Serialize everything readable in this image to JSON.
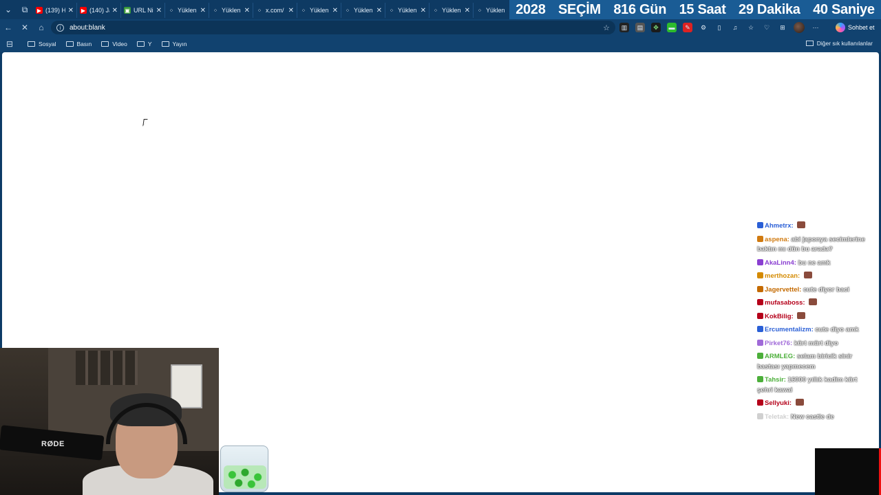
{
  "tabs": [
    {
      "title": "(139) H",
      "fav_color": "#ff0000",
      "fav_glyph": "▶"
    },
    {
      "title": "(140) Ja",
      "fav_color": "#ff0000",
      "fav_glyph": "▶"
    },
    {
      "title": "URL Ni",
      "fav_color": "#3a9a3a",
      "fav_glyph": "▣"
    },
    {
      "title": "Yüklen",
      "fav_color": "transparent",
      "fav_glyph": "⁘"
    },
    {
      "title": "Yüklen",
      "fav_color": "transparent",
      "fav_glyph": "⁘"
    },
    {
      "title": "x.com/",
      "fav_color": "transparent",
      "fav_glyph": "⁘"
    },
    {
      "title": "Yüklen",
      "fav_color": "transparent",
      "fav_glyph": "⁘"
    },
    {
      "title": "Yüklen",
      "fav_color": "transparent",
      "fav_glyph": "⁘"
    },
    {
      "title": "Yüklen",
      "fav_color": "transparent",
      "fav_glyph": "⁘"
    },
    {
      "title": "Yüklen",
      "fav_color": "transparent",
      "fav_glyph": "⁘"
    },
    {
      "title": "Yüklen",
      "fav_color": "transparent",
      "fav_glyph": "⁘"
    }
  ],
  "countdown": {
    "year": "2028",
    "label": "SEÇİM",
    "days": "816 Gün",
    "hours": "15 Saat",
    "minutes": "29 Dakika",
    "seconds": "40 Saniye"
  },
  "address": {
    "url": "about:blank"
  },
  "copilot_label": "Sohbet et",
  "bookmarks": [
    "Sosyal",
    "Basın",
    "Video",
    "Y",
    "Yayın"
  ],
  "bookmarks_other": "Diğer sık kullanılanlar",
  "chat": [
    {
      "user": "Ahmetrx:",
      "color": "#2a5fd6",
      "text": "",
      "emote": true
    },
    {
      "user": "aspena:",
      "color": "#d07a10",
      "text": "abi japonya secimlerine baktın mı dün bu arada?",
      "emote": false
    },
    {
      "user": "AkaLinn4:",
      "color": "#8a3fd1",
      "text": "bu ne amk",
      "emote": false
    },
    {
      "user": "merthozan:",
      "color": "#d48a00",
      "text": "",
      "emote": true
    },
    {
      "user": "Jagervettel:",
      "color": "#c46a00",
      "text": "cute diyor baci",
      "emote": false
    },
    {
      "user": "mufasaboss:",
      "color": "#b5001a",
      "text": "",
      "emote": true
    },
    {
      "user": "KokBilig:",
      "color": "#b5001a",
      "text": "",
      "emote": true
    },
    {
      "user": "Ercumentalizm:",
      "color": "#2a5fd6",
      "text": "cute diyo amk",
      "emote": false
    },
    {
      "user": "Pirket76:",
      "color": "#a06ad8",
      "text": "kürt mürt diyo",
      "emote": false
    },
    {
      "user": "ARMLEG:",
      "color": "#4caf3a",
      "text": "selam biricik sinir bastası yapmecem",
      "emote": false
    },
    {
      "user": "Tahsir:",
      "color": "#4caf3a",
      "text": "16000 yıllık kadim kürt şehri kawai",
      "emote": false
    },
    {
      "user": "Sellyuki:",
      "color": "#b5001a",
      "text": "",
      "emote": true
    },
    {
      "user": "Teletak:",
      "color": "#d0d0d0",
      "text": "New castle de",
      "emote": false
    }
  ],
  "webcam_brand": "RØDE",
  "colors": {
    "tabbar_bg": "#0e3a63",
    "countdown_bg": "#1a5c95",
    "toolbar_bg": "#11426f"
  }
}
